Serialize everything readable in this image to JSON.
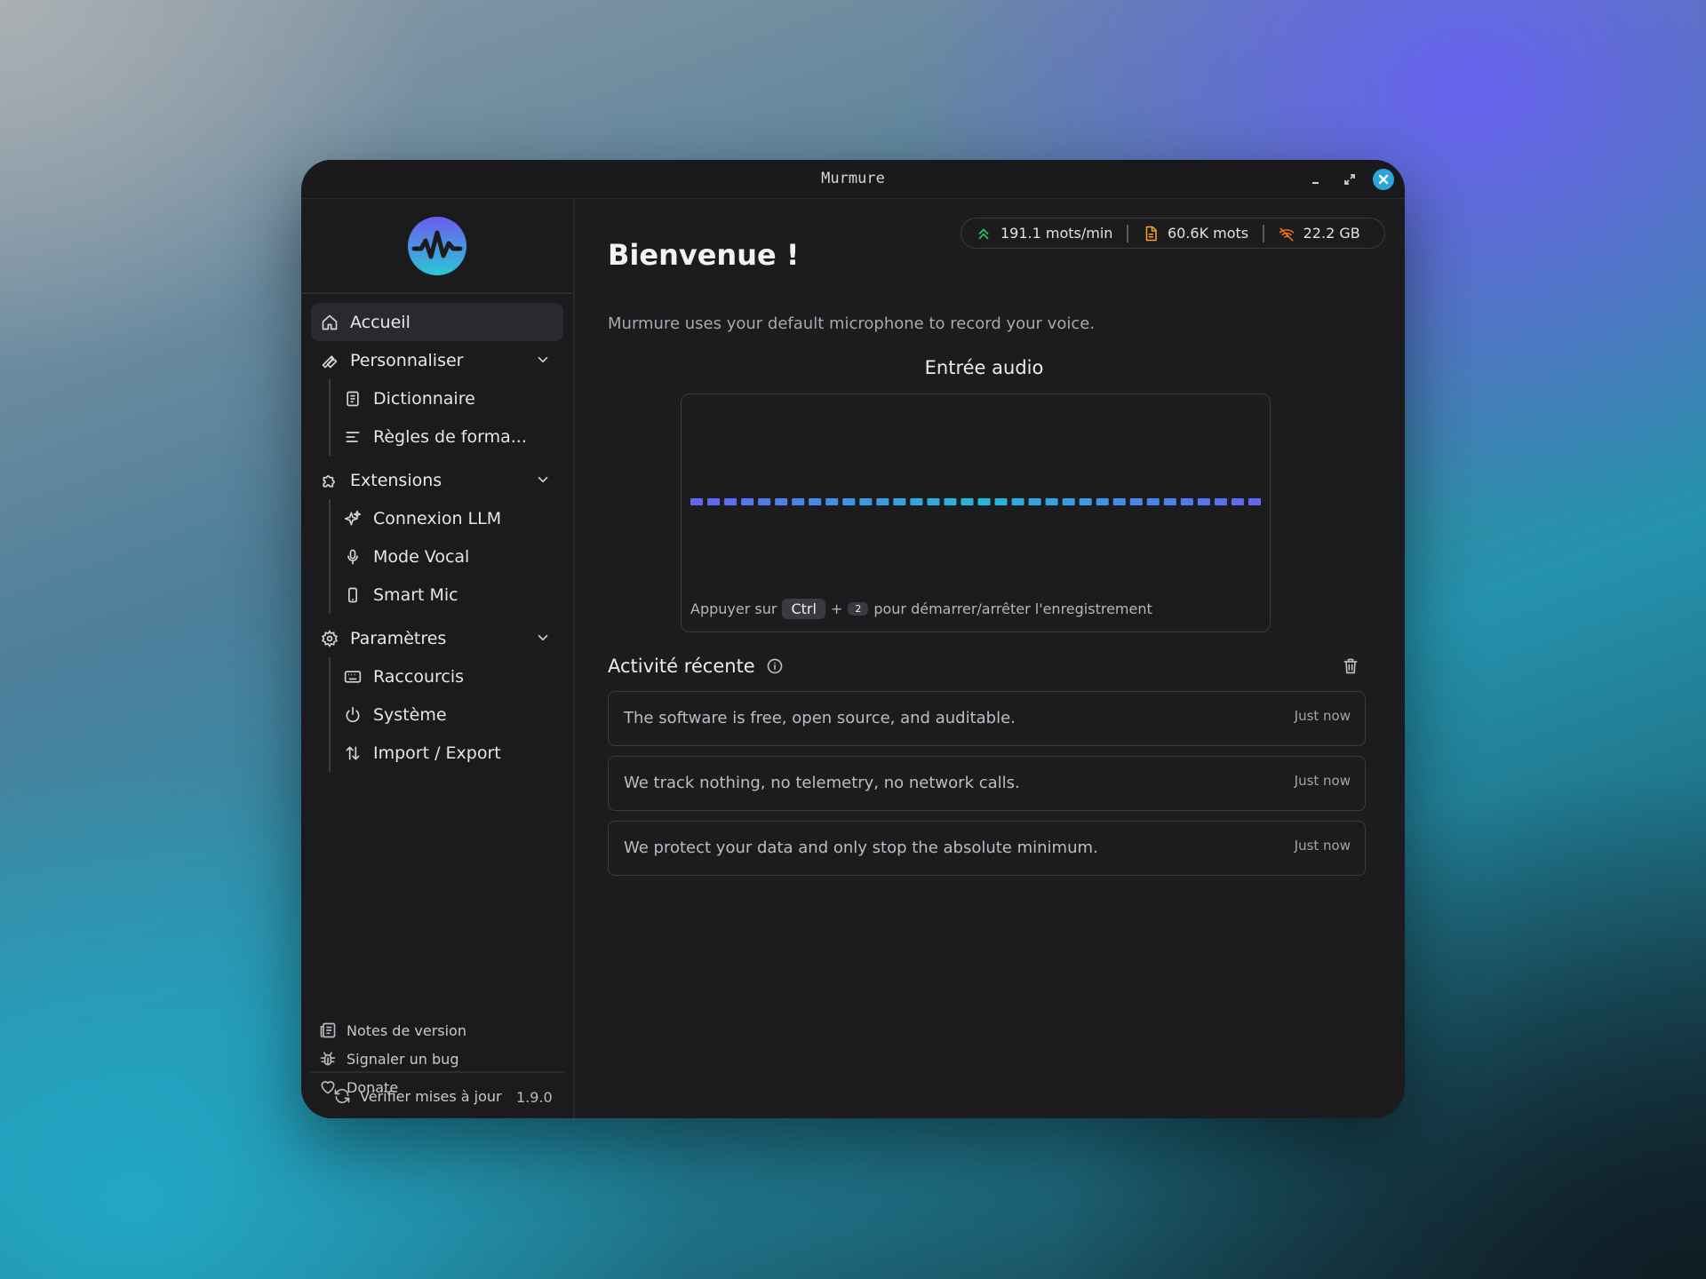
{
  "window": {
    "title": "Murmure"
  },
  "colors": {
    "accent": "#6366f1",
    "accent_cyan": "#22b8d8",
    "background": "#1c1c1f"
  },
  "sidebar": {
    "items": [
      {
        "label": "Accueil",
        "icon": "home-icon",
        "active": true
      }
    ],
    "groups": [
      {
        "label": "Personnaliser",
        "icon": "wrench-icon",
        "expanded": true,
        "items": [
          {
            "label": "Dictionnaire",
            "icon": "book-icon"
          },
          {
            "label": "Règles de forma...",
            "icon": "text-align-icon"
          }
        ]
      },
      {
        "label": "Extensions",
        "icon": "puzzle-icon",
        "expanded": true,
        "items": [
          {
            "label": "Connexion LLM",
            "icon": "sparkles-icon"
          },
          {
            "label": "Mode Vocal",
            "icon": "microphone-icon"
          },
          {
            "label": "Smart Mic",
            "icon": "smartphone-icon"
          }
        ]
      },
      {
        "label": "Paramètres",
        "icon": "gear-icon",
        "expanded": true,
        "items": [
          {
            "label": "Raccourcis",
            "icon": "keyboard-icon"
          },
          {
            "label": "Système",
            "icon": "power-icon"
          },
          {
            "label": "Import / Export",
            "icon": "arrows-updown-icon"
          }
        ]
      }
    ],
    "footer_links": [
      {
        "label": "Notes de version",
        "icon": "newspaper-icon"
      },
      {
        "label": "Signaler un bug",
        "icon": "bug-icon"
      },
      {
        "label": "Donate",
        "icon": "heart-icon"
      }
    ],
    "update_label": "Vérifier mises à jour",
    "version": "1.9.0"
  },
  "stats": [
    {
      "label": "191.1 mots/min",
      "icon": "chevrons-up-icon",
      "color": "#22c55e"
    },
    {
      "label": "60.6K mots",
      "icon": "document-icon",
      "color": "#f5a524"
    },
    {
      "label": "22.2 GB",
      "icon": "wifi-off-icon",
      "color": "#f97316"
    }
  ],
  "main": {
    "title": "Bienvenue !",
    "subtitle": "Murmure uses your default microphone to record your voice.",
    "audio_title": "Entrée audio",
    "hint": {
      "before": "Appuyer sur",
      "key1": "Ctrl",
      "plus": "+",
      "key2": "2",
      "after": "pour démarrer/arrêter l'enregistrement"
    },
    "activity_title": "Activité récente",
    "activity": [
      {
        "text": "The software is free, open source, and auditable.",
        "time": "Just now"
      },
      {
        "text": "We track nothing, no telemetry, no network calls.",
        "time": "Just now"
      },
      {
        "text": "We protect your data and only stop the absolute minimum.",
        "time": "Just now"
      }
    ]
  }
}
